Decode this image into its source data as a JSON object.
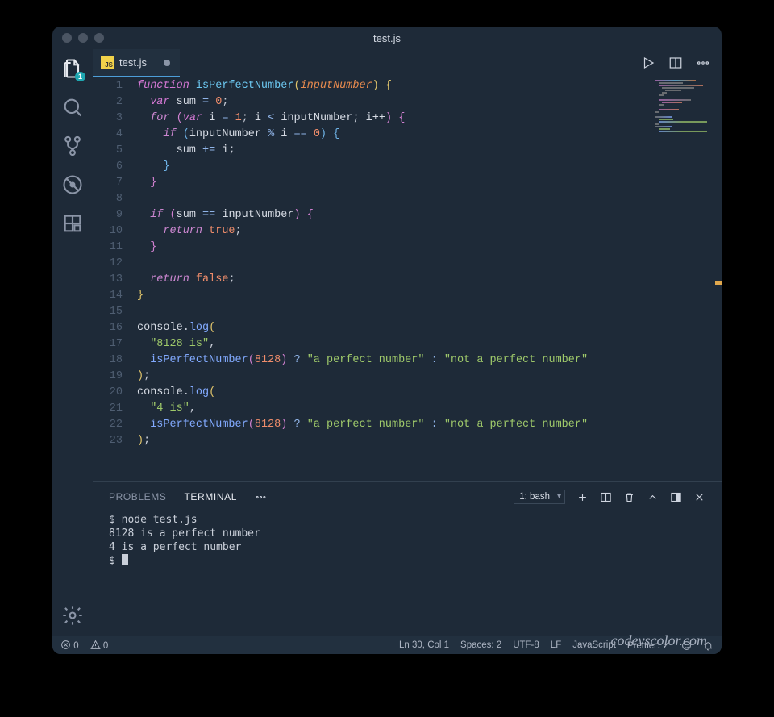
{
  "window": {
    "title": "test.js"
  },
  "activitybar": {
    "badge": "1"
  },
  "tab": {
    "filename": "test.js",
    "jsicon": "JS"
  },
  "editor": {
    "line_numbers": [
      "1",
      "2",
      "3",
      "4",
      "5",
      "6",
      "7",
      "8",
      "9",
      "10",
      "11",
      "12",
      "13",
      "14",
      "15",
      "16",
      "17",
      "18",
      "19",
      "20",
      "21",
      "22",
      "23"
    ]
  },
  "code": {
    "l1": {
      "function": "function",
      "name": "isPerfectNumber",
      "param": "inputNumber"
    },
    "l2": {
      "var": "var",
      "sum": "sum",
      "zero": "0"
    },
    "l3": {
      "for": "for",
      "var": "var",
      "i": "i",
      "one": "1",
      "input": "inputNumber",
      "ipp": "i++"
    },
    "l4": {
      "if": "if",
      "input": "inputNumber",
      "mod": "%",
      "i": "i",
      "eq": "==",
      "zero": "0"
    },
    "l5": {
      "sum": "sum",
      "i": "i"
    },
    "l9": {
      "if": "if",
      "sum": "sum",
      "eq": "==",
      "input": "inputNumber"
    },
    "l10": {
      "return": "return",
      "true": "true"
    },
    "l13": {
      "return": "return",
      "false": "false"
    },
    "l16": {
      "console": "console",
      "log": "log"
    },
    "l17": {
      "str": "\"8128 is\""
    },
    "l18": {
      "fn": "isPerfectNumber",
      "arg": "8128",
      "t": "\"a perfect number\"",
      "f": "\"not a perfect number\""
    },
    "l20": {
      "console": "console",
      "log": "log"
    },
    "l21": {
      "str": "\"4 is\""
    },
    "l22": {
      "fn": "isPerfectNumber",
      "arg": "8128",
      "t": "\"a perfect number\"",
      "f": "\"not a perfect number\""
    }
  },
  "panel": {
    "tabs": {
      "problems": "PROBLEMS",
      "terminal": "TERMINAL"
    },
    "terminal_select": "1: bash"
  },
  "terminal": {
    "l1": "$ node test.js",
    "l2": "8128 is a perfect number",
    "l3": "4 is a perfect number",
    "l4": "$ "
  },
  "watermark": "codevscolor.com",
  "status": {
    "errors": "0",
    "warnings": "0",
    "cursor": "Ln 30, Col 1",
    "spaces": "Spaces: 2",
    "encoding": "UTF-8",
    "eol": "LF",
    "lang": "JavaScript",
    "prettier": "Prettier: ✓"
  }
}
